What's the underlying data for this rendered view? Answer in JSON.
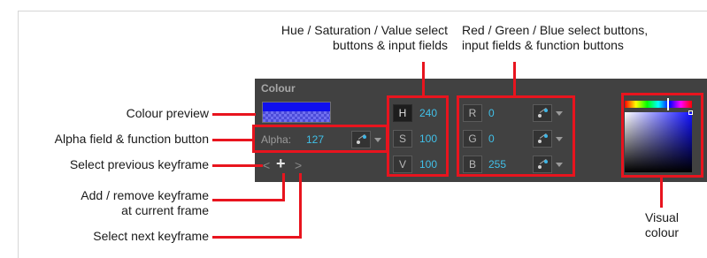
{
  "callouts": {
    "hsv_top": "Hue / Saturation / Value select\nbuttons & input fields",
    "rgb_top": "Red / Green / Blue select buttons,\ninput fields & function buttons",
    "colour_preview": "Colour preview",
    "alpha_field": "Alpha field & function button",
    "select_prev": "Select previous keyframe",
    "add_remove": "Add / remove keyframe\nat current frame",
    "select_next": "Select next keyframe",
    "visual_colour": "Visual\ncolour"
  },
  "panel": {
    "title": "Colour",
    "alpha_label": "Alpha:",
    "alpha_value": "127",
    "hsv": [
      {
        "key": "H",
        "value": "240",
        "active": true
      },
      {
        "key": "S",
        "value": "100",
        "active": false
      },
      {
        "key": "V",
        "value": "100",
        "active": false
      }
    ],
    "rgb": [
      {
        "key": "R",
        "value": "0"
      },
      {
        "key": "G",
        "value": "0"
      },
      {
        "key": "B",
        "value": "255"
      }
    ],
    "keyframe": {
      "prev": "<",
      "add": "+",
      "next": ">"
    }
  },
  "colors": {
    "annotation_red": "#e8141e",
    "panel_bg": "#414141",
    "value_text": "#41c0e8",
    "preview_colour": "#1010ee"
  }
}
